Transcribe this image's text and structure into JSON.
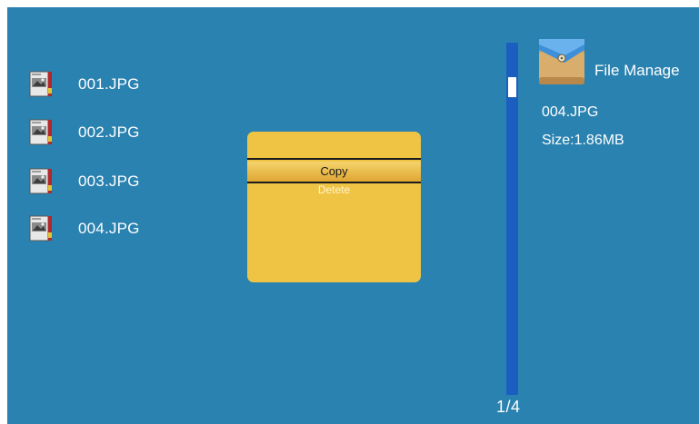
{
  "files": [
    {
      "name": "001.JPG",
      "icon": "image-file-icon"
    },
    {
      "name": "002.JPG",
      "icon": "image-file-icon"
    },
    {
      "name": "003.JPG",
      "icon": "image-file-icon"
    },
    {
      "name": "004.JPG",
      "icon": "image-file-icon"
    }
  ],
  "context_menu": {
    "items": [
      "Copy",
      "Detete"
    ],
    "selected": "Copy"
  },
  "scrollbar": {
    "page_indicator": "1/4",
    "position_fraction": 0.1
  },
  "panel": {
    "title": "File Manage",
    "icon": "folder-icon",
    "selected_file_name": "004.JPG",
    "selected_file_size": "Size:1.86MB"
  },
  "colors": {
    "background": "#2a82b0",
    "popup": "#efc445",
    "scroll_track": "#1a5fc0",
    "text": "#ffffff"
  }
}
